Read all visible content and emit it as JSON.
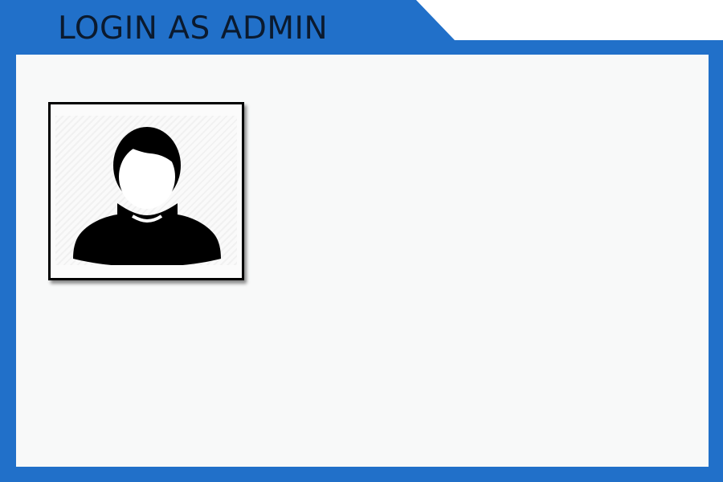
{
  "window": {
    "title": "LOGIN AS ADMIN"
  },
  "colors": {
    "frame": "#2170c9",
    "panel": "#f8f9f9",
    "title_text": "#0b1a2e",
    "card_border": "#000000"
  },
  "avatar": {
    "icon": "user-silhouette-icon"
  }
}
